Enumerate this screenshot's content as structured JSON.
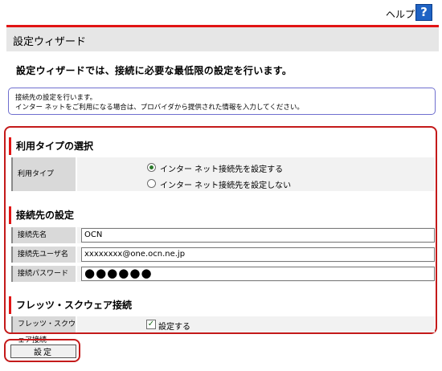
{
  "header": {
    "help_label": "ヘルプ",
    "help_icon": "?"
  },
  "page": {
    "title": "設定ウィザード",
    "intro": "設定ウィザードでは、接続に必要な最低限の設定を行います。",
    "info_lines": [
      "接続先の設定を行います。",
      "インター ネットをご利用になる場合は、プロバイダから提供された情報を入力してください。"
    ]
  },
  "usage_section": {
    "heading": "利用タイプの選択",
    "label": "利用タイプ",
    "options": [
      {
        "label": "インター ネット接続先を設定する",
        "selected": true
      },
      {
        "label": "インター ネット接続先を設定しない",
        "selected": false
      }
    ]
  },
  "connection_section": {
    "heading": "接続先の設定",
    "fields": [
      {
        "label": "接続先名",
        "value": "OCN"
      },
      {
        "label": "接続先ユーザ名",
        "value": "xxxxxxxx@one.ocn.ne.jp"
      },
      {
        "label": "接続パスワード",
        "value": "●●●●●●"
      }
    ]
  },
  "flets_section": {
    "heading": "フレッツ・スクウェア接続",
    "label": "フレッツ・スクウェア接続",
    "checkbox_label": "設定する",
    "checked": true
  },
  "footer": {
    "submit_label": "設定"
  },
  "colors": {
    "accent_red": "#e11414",
    "frame_red": "#c41a1a",
    "info_border": "#6f6fcf",
    "help_blue": "#1f63c4"
  }
}
